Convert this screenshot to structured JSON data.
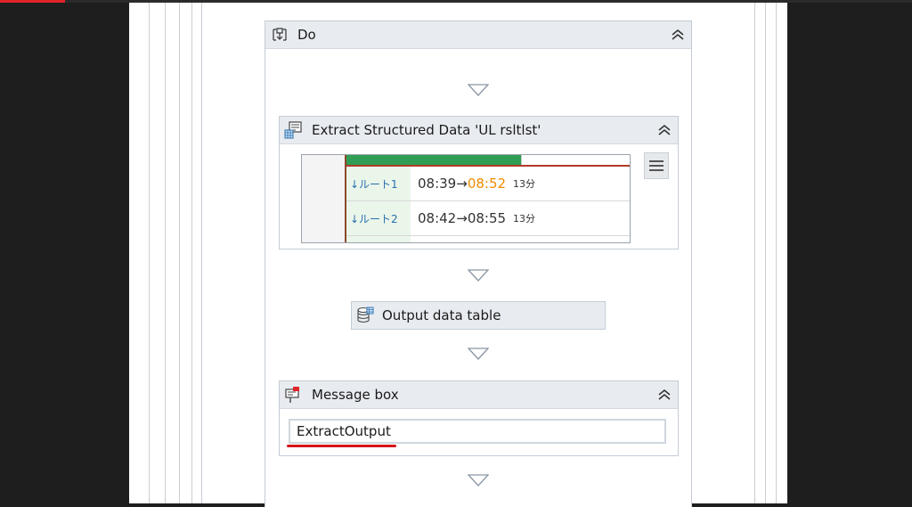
{
  "do_block": {
    "title": "Do"
  },
  "extract": {
    "title": "Extract Structured Data 'UL  rsltlst'",
    "rows": [
      {
        "route": "↓ルート1",
        "depart": "08:39",
        "arrow": "→",
        "arrive": "08:52",
        "duration": "13分"
      },
      {
        "route": "↓ルート2",
        "depart": "08:42",
        "arrow": "→",
        "arrive": "08:55",
        "duration": "13分"
      }
    ]
  },
  "output_table": {
    "title": "Output data table"
  },
  "message_box": {
    "title": "Message box",
    "value": "ExtractOutput"
  },
  "colors": {
    "accent_red": "#d8141c",
    "route_blue": "#2a6fb0",
    "arrive_orange": "#f08a00",
    "header_bg": "#e8ecf0"
  }
}
